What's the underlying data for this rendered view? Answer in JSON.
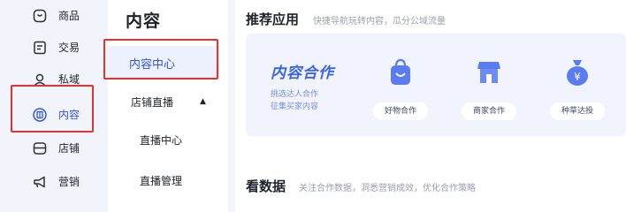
{
  "sidebar": {
    "items": [
      {
        "label": "商品",
        "icon": "product-icon"
      },
      {
        "label": "交易",
        "icon": "trade-icon"
      },
      {
        "label": "私域",
        "icon": "private-domain-icon"
      },
      {
        "label": "内容",
        "icon": "content-icon",
        "active": true
      },
      {
        "label": "店铺",
        "icon": "store-icon"
      },
      {
        "label": "营销",
        "icon": "marketing-icon"
      }
    ]
  },
  "submenu": {
    "title": "内容",
    "items": [
      {
        "label": "内容中心",
        "active": true
      },
      {
        "label": "店铺直播",
        "expandable": true
      },
      {
        "label": "直播中心"
      },
      {
        "label": "直播管理"
      }
    ]
  },
  "recommended": {
    "title": "推荐应用",
    "subtitle": "快捷导航玩转内容，瓜分公域流量",
    "promo": {
      "title": "内容合作",
      "lines": [
        "挑选达人合作",
        "征集买家内容"
      ]
    },
    "apps": [
      {
        "label": "好物合作",
        "icon": "shopping-bag-icon"
      },
      {
        "label": "商家合作",
        "icon": "storefront-icon"
      },
      {
        "label": "种草达投",
        "icon": "money-bag-icon"
      }
    ]
  },
  "data_section": {
    "title": "看数据",
    "subtitle": "关注合作数据，洞悉营销成效，优化合作策略"
  },
  "colors": {
    "accent": "#2f54eb",
    "highlight_box": "#e5322d",
    "rail_bg": "#f2f4fb",
    "banner_bg": "#f1f4fd",
    "app_icon": "#5b7cf0"
  }
}
